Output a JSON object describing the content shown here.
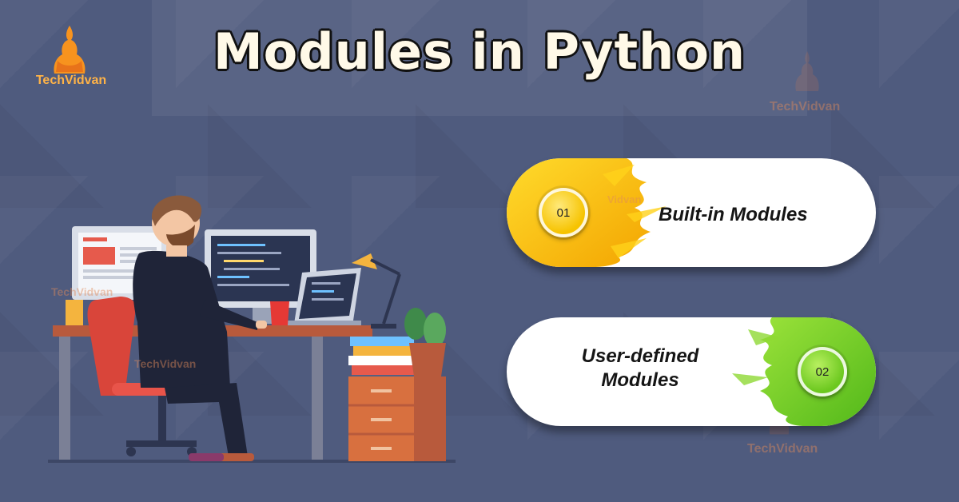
{
  "header": {
    "title": "Modules in Python"
  },
  "brand": {
    "name": "TechVidvan",
    "accent": "#f7931e"
  },
  "items": [
    {
      "number": "01",
      "label": "Built-in Modules",
      "color": "#f9c100"
    },
    {
      "number": "02",
      "label_line1": "User-defined",
      "label_line2": "Modules",
      "color": "#7bd321"
    }
  ],
  "watermarks": [
    "TechVidvan",
    "Vidvan",
    "Techvidvan"
  ]
}
